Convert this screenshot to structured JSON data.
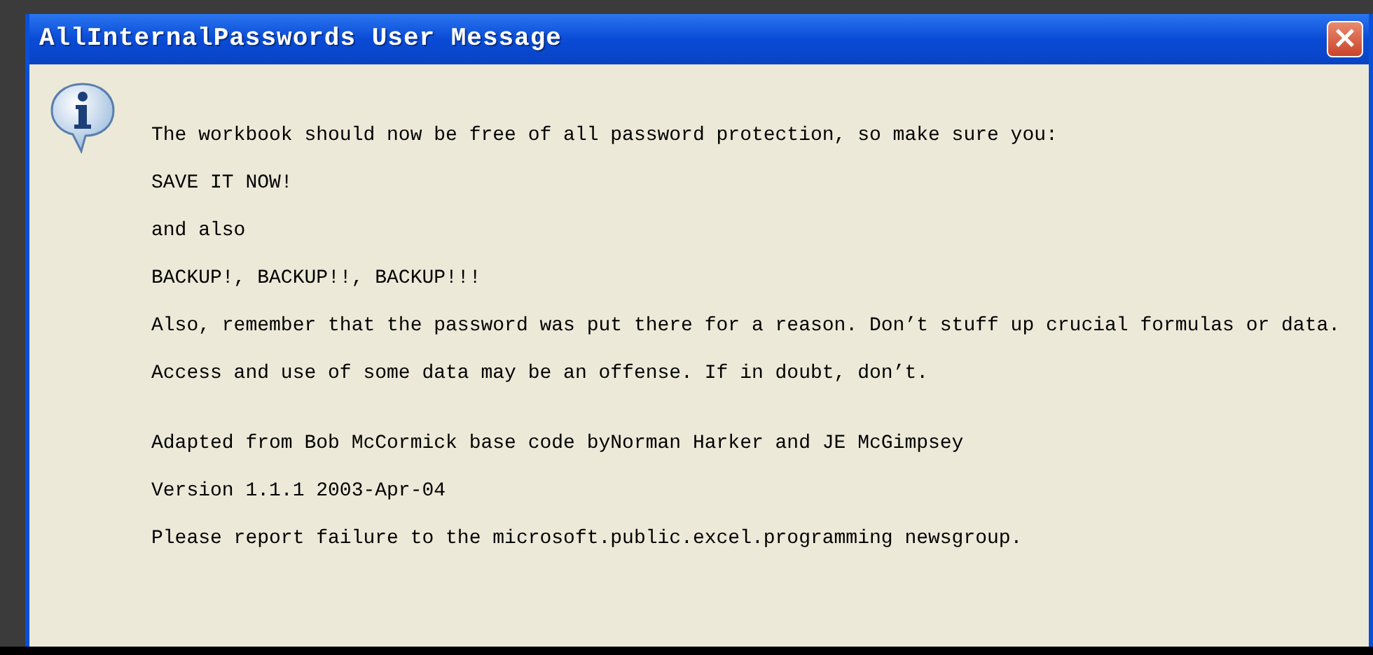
{
  "window": {
    "title": "AllInternalPasswords User Message",
    "close_label": "×"
  },
  "message": {
    "lines": [
      "The workbook should now be free of all password protection, so make sure you:",
      "SAVE IT NOW!",
      "and also",
      "BACKUP!, BACKUP!!, BACKUP!!!",
      "Also, remember that the password was put there for a reason. Don’t stuff up crucial formulas or data.",
      "Access and use of some data may be an offense. If in doubt, don’t."
    ],
    "footer": [
      "Adapted from Bob McCormick base code byNorman Harker and JE McGimpsey",
      "Version 1.1.1 2003-Apr-04",
      "Please report failure to the microsoft.public.excel.programming newsgroup."
    ]
  }
}
